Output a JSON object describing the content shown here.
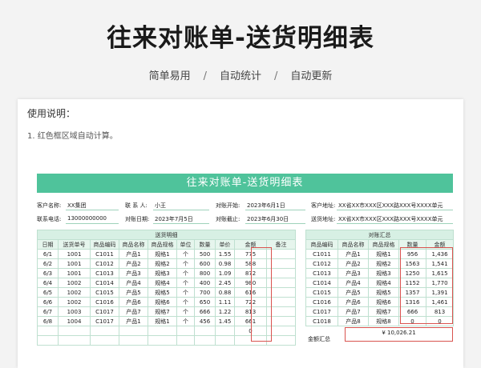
{
  "header": {
    "title": "往来对账单-送货明细表",
    "features": [
      "简单易用",
      "自动统计",
      "自动更新"
    ],
    "separator": "/"
  },
  "usage": {
    "title": "使用说明：",
    "line1": "1. 红色框区域自动计算。"
  },
  "sheet": {
    "title": "往来对账单-送货明细表",
    "info": {
      "customer_name_label": "客户名称:",
      "customer_name": "XX集团",
      "contact_label": "联 系 人:",
      "contact": "小王",
      "start_label": "对账开始:",
      "start_date": "2023年6月1日",
      "customer_addr_label": "客户地址:",
      "customer_addr": "XX省XX市XXX区XXX路XXX号XXXX单元",
      "phone_label": "联系电话:",
      "phone": "13000000000",
      "recon_date_label": "对账日期:",
      "recon_date": "2023年7月5日",
      "end_label": "对账截止:",
      "end_date": "2023年6月30日",
      "delivery_addr_label": "送货地址:",
      "delivery_addr": "XX省XX市XXX区XXX路XXX号XXXX单元"
    },
    "detail": {
      "section_title": "送货明细",
      "columns": [
        "日期",
        "送货单号",
        "商品编码",
        "商品名称",
        "商品规格",
        "单位",
        "数量",
        "单价",
        "金额",
        "备注"
      ],
      "rows": [
        [
          "6/1",
          "1001",
          "C1011",
          "产品1",
          "规格1",
          "个",
          "500",
          "1.55",
          "775",
          ""
        ],
        [
          "6/2",
          "1001",
          "C1012",
          "产品2",
          "规格2",
          "个",
          "600",
          "0.98",
          "588",
          ""
        ],
        [
          "6/3",
          "1001",
          "C1013",
          "产品3",
          "规格3",
          "个",
          "800",
          "1.09",
          "872",
          ""
        ],
        [
          "6/4",
          "1002",
          "C1014",
          "产品4",
          "规格4",
          "个",
          "400",
          "2.45",
          "980",
          ""
        ],
        [
          "6/5",
          "1002",
          "C1015",
          "产品5",
          "规格5",
          "个",
          "700",
          "0.88",
          "616",
          ""
        ],
        [
          "6/6",
          "1002",
          "C1016",
          "产品6",
          "规格6",
          "个",
          "650",
          "1.11",
          "722",
          ""
        ],
        [
          "6/7",
          "1003",
          "C1017",
          "产品7",
          "规格7",
          "个",
          "666",
          "1.22",
          "813",
          ""
        ],
        [
          "6/8",
          "1004",
          "C1017",
          "产品1",
          "规格1",
          "个",
          "456",
          "1.45",
          "661",
          ""
        ],
        [
          "",
          "",
          "",
          "",
          "",
          "",
          "",
          "",
          "0",
          ""
        ],
        [
          "",
          "",
          "",
          "",
          "",
          "",
          "",
          "",
          "",
          ""
        ]
      ]
    },
    "summary": {
      "section_title": "对账汇总",
      "columns": [
        "商品编码",
        "商品名称",
        "商品规格",
        "数量",
        "金额"
      ],
      "rows": [
        [
          "C1011",
          "产品1",
          "规格1",
          "956",
          "1,436"
        ],
        [
          "C1012",
          "产品2",
          "规格2",
          "1563",
          "1,541"
        ],
        [
          "C1013",
          "产品3",
          "规格3",
          "1250",
          "1,615"
        ],
        [
          "C1014",
          "产品4",
          "规格4",
          "1152",
          "1,770"
        ],
        [
          "C1015",
          "产品5",
          "规格5",
          "1357",
          "1,391"
        ],
        [
          "C1016",
          "产品6",
          "规格6",
          "1316",
          "1,461"
        ],
        [
          "C1017",
          "产品7",
          "规格7",
          "666",
          "813"
        ],
        [
          "C1018",
          "产品8",
          "规格8",
          "0",
          "0"
        ]
      ],
      "total_label": "金额汇总",
      "total_value": "¥ 10,026.21"
    }
  },
  "colors": {
    "accent": "#4fc39b",
    "header_fill": "#d7f0e4",
    "red_box": "#d9534f"
  }
}
